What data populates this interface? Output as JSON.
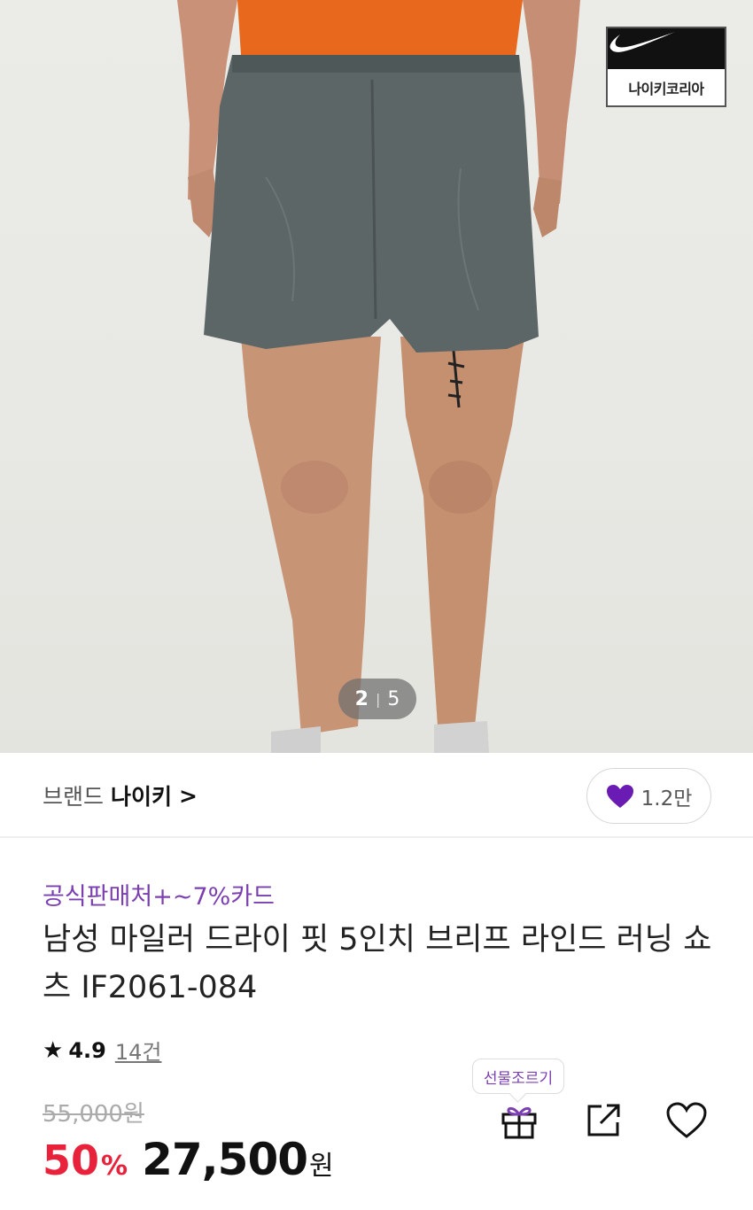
{
  "product_image": {
    "brand_badge_text": "나이키코리아",
    "pager": {
      "current": "2",
      "separator": "|",
      "total": "5"
    }
  },
  "brand": {
    "label": "브랜드",
    "name": "나이키",
    "chevron": ">"
  },
  "like": {
    "count": "1.2만",
    "icon": "heart-icon",
    "color": "#6a1bb3"
  },
  "product": {
    "promo_text": "공식판매처+~7%카드",
    "title": "남성 마일러 드라이 핏 5인치 브리프 라인드 러닝 쇼츠 IF2061-084"
  },
  "rating": {
    "star": "★",
    "score": "4.9",
    "review_count": "14건"
  },
  "price": {
    "original": "55,000원",
    "discount_rate": "50",
    "discount_sign": "%",
    "sale": "27,500",
    "currency": "원"
  },
  "actions": {
    "gift_tooltip": "선물조르기",
    "gift_icon": "gift-icon",
    "share_icon": "share-icon",
    "wishlist_icon": "heart-outline-icon"
  },
  "colors": {
    "promo": "#7b3fb0",
    "discount": "#e8223a",
    "like": "#6a1bb3"
  }
}
